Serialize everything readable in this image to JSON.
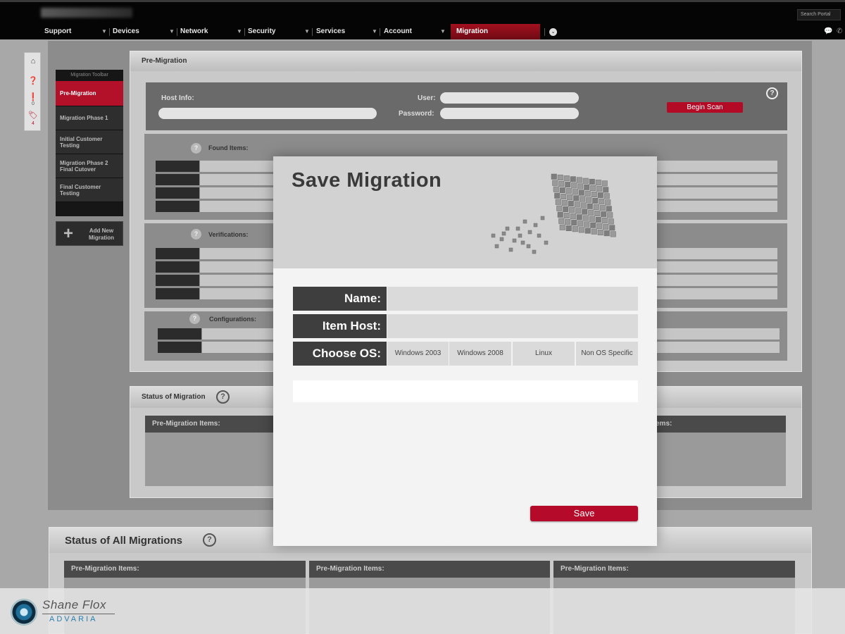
{
  "topbar": {
    "search_label": "Search Portal",
    "nav": [
      {
        "label": "Support"
      },
      {
        "label": "Devices"
      },
      {
        "label": "Network"
      },
      {
        "label": "Security"
      },
      {
        "label": "Services"
      },
      {
        "label": "Account"
      },
      {
        "label": "Migration"
      }
    ],
    "active_color": "#b3102a"
  },
  "side_icons": {
    "alerts_count": "0",
    "tags_count": "4"
  },
  "toolbar": {
    "title": "Migration Toolbar",
    "items": [
      {
        "label": "Pre-Migration"
      },
      {
        "label": "Migration Phase 1"
      },
      {
        "label": "Initial Customer Testing"
      },
      {
        "label": "Migration Phase 2 Final Cutover"
      },
      {
        "label": "Final Customer Testing"
      }
    ],
    "add_new": "Add New Migration"
  },
  "pre_migration": {
    "title": "Pre-Migration",
    "host_info_label": "Host Info:",
    "user_label": "User:",
    "password_label": "Password:",
    "begin_scan": "Begin Scan",
    "found_items": "Found Items:",
    "verifications": "Verifications:",
    "configurations": "Configurations:"
  },
  "status_of_migration": {
    "title": "Status of Migration",
    "col1": "Pre-Migration Items:",
    "col2_partial": "ems:"
  },
  "status_all": {
    "title": "Status of All Migrations",
    "cols": [
      "Pre-Migration Items:",
      "Pre-Migration Items:",
      "Pre-Migration Items:"
    ]
  },
  "modal": {
    "title": "Save Migration",
    "name_label": "Name:",
    "item_host_label": "Item Host:",
    "choose_os_label": "Choose OS:",
    "os_options": [
      "Windows 2003",
      "Windows 2008",
      "Linux",
      "Non OS Specific"
    ],
    "save_label": "Save"
  },
  "footer": {
    "brand_name": "Shane Flox",
    "brand_sub": "ADVARIA"
  }
}
